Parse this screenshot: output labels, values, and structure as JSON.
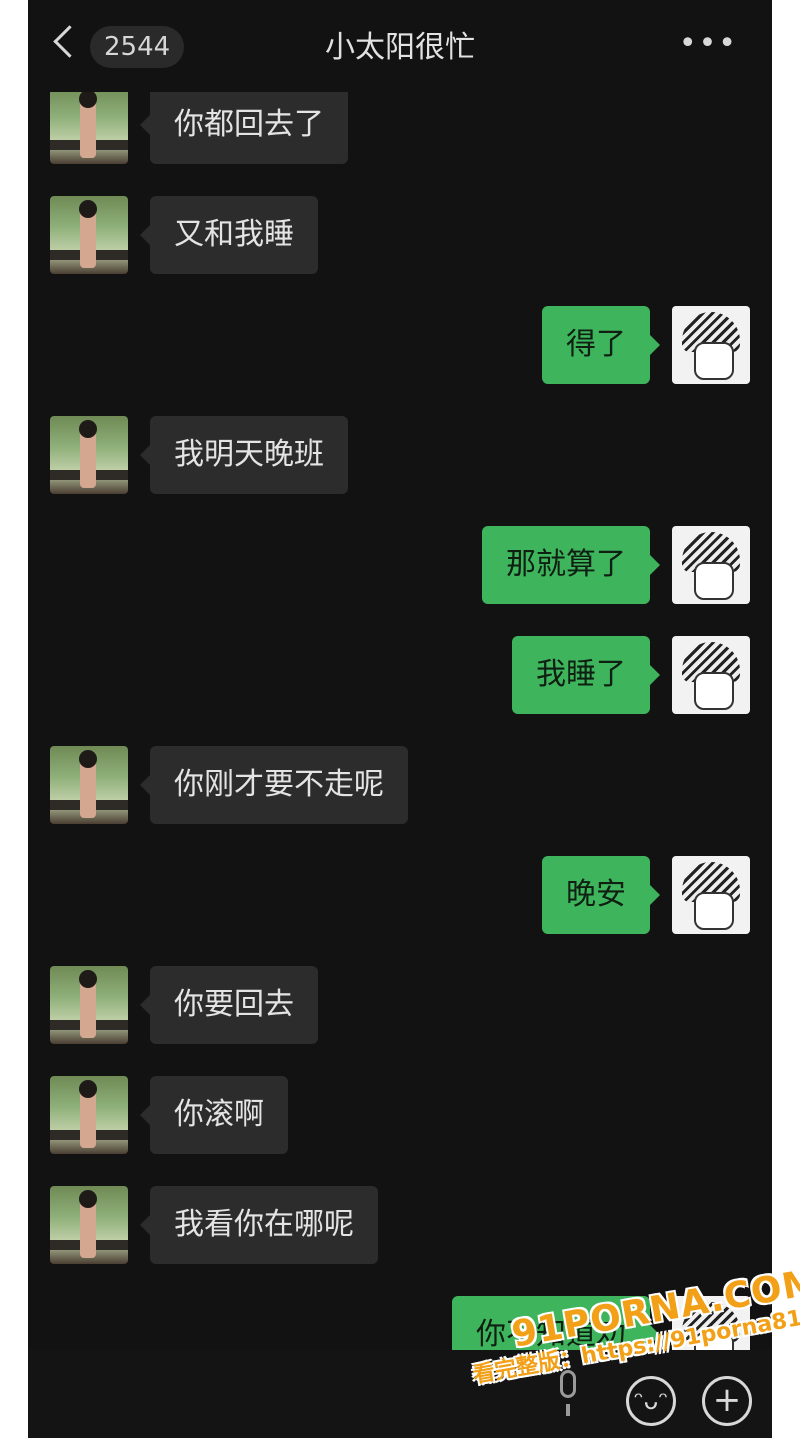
{
  "header": {
    "unread_count": "2544",
    "title": "小太阳很忙",
    "more_label": "•••"
  },
  "messages": [
    {
      "side": "in",
      "text": "你都回去了"
    },
    {
      "side": "in",
      "text": "又和我睡"
    },
    {
      "side": "out",
      "text": "得了"
    },
    {
      "side": "in",
      "text": "我明天晚班"
    },
    {
      "side": "out",
      "text": "那就算了"
    },
    {
      "side": "out",
      "text": "我睡了"
    },
    {
      "side": "in",
      "text": "你刚才要不走呢"
    },
    {
      "side": "out",
      "text": "晚安"
    },
    {
      "side": "in",
      "text": "你要回去"
    },
    {
      "side": "in",
      "text": "你滚啊"
    },
    {
      "side": "in",
      "text": "我看你在哪呢"
    },
    {
      "side": "out",
      "text": "你不知道劝"
    }
  ],
  "input_bar": {
    "voice_icon": "microphone-icon",
    "emoji_icon": "smiley-icon",
    "plus_icon": "plus-icon",
    "emoji_glyph": "ᵔᴗᵔ",
    "plus_glyph": "+"
  },
  "watermark": {
    "brand": "91PORNA.COM",
    "url_text": "看完整版：https://91porna81.com"
  },
  "colors": {
    "background": "#121212",
    "incoming_bubble": "#2c2c2c",
    "outgoing_bubble": "#3eb55d",
    "watermark": "#f2a017"
  }
}
